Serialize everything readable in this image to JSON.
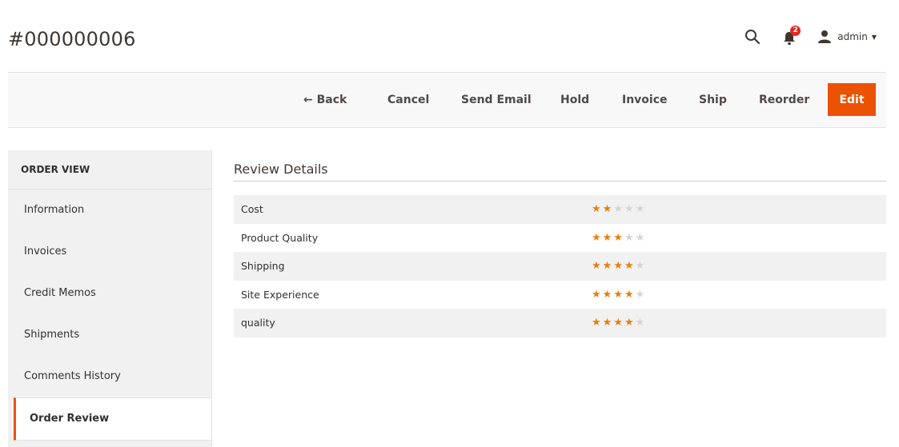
{
  "header": {
    "page_title": "#000000006",
    "notifications_count": "2",
    "user_name": "admin"
  },
  "action_bar": {
    "back": "← Back",
    "cancel": "Cancel",
    "send_email": "Send Email",
    "hold": "Hold",
    "invoice": "Invoice",
    "ship": "Ship",
    "reorder": "Reorder",
    "edit": "Edit"
  },
  "sidebar": {
    "title": "ORDER VIEW",
    "items": [
      {
        "label": "Information"
      },
      {
        "label": "Invoices"
      },
      {
        "label": "Credit Memos"
      },
      {
        "label": "Shipments"
      },
      {
        "label": "Comments History"
      },
      {
        "label": "Order Review"
      }
    ],
    "active": "Order Review"
  },
  "review": {
    "title": "Review Details",
    "max_rating": 5,
    "rows": [
      {
        "label": "Cost",
        "rating": 2
      },
      {
        "label": "Product Quality",
        "rating": 3
      },
      {
        "label": "Shipping",
        "rating": 4
      },
      {
        "label": "Site Experience",
        "rating": 4
      },
      {
        "label": "quality",
        "rating": 4
      }
    ]
  },
  "colors": {
    "accent": "#eb5202",
    "star_on": "#eb7d0c",
    "star_off": "#d4d4d4"
  }
}
